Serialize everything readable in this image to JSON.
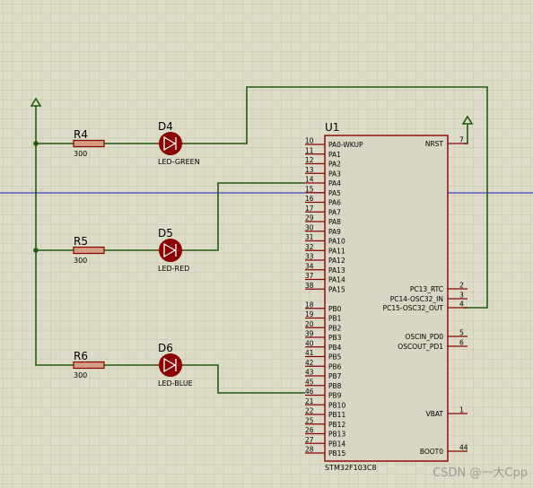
{
  "colors": {
    "background": "#dcdcc8",
    "grid": "#c4c4ad",
    "wire": "#1f5a12",
    "component": "#8b0000",
    "chip_fill": "#d8d7c5",
    "text": "#000000",
    "guide_line": "#1d1dbb"
  },
  "resistors": [
    {
      "ref": "R4",
      "value": "300"
    },
    {
      "ref": "R5",
      "value": "300"
    },
    {
      "ref": "R6",
      "value": "300"
    }
  ],
  "leds": [
    {
      "ref": "D4",
      "label": "LED-GREEN"
    },
    {
      "ref": "D5",
      "label": "LED-RED"
    },
    {
      "ref": "D6",
      "label": "LED-BLUE"
    }
  ],
  "chip": {
    "ref": "U1",
    "part": "STM32F103C8",
    "left_pins": [
      {
        "num": "10",
        "name": "PA0-WKUP"
      },
      {
        "num": "11",
        "name": "PA1"
      },
      {
        "num": "12",
        "name": "PA2"
      },
      {
        "num": "13",
        "name": "PA3"
      },
      {
        "num": "14",
        "name": "PA4"
      },
      {
        "num": "15",
        "name": "PA5"
      },
      {
        "num": "16",
        "name": "PA6"
      },
      {
        "num": "17",
        "name": "PA7"
      },
      {
        "num": "29",
        "name": "PA8"
      },
      {
        "num": "30",
        "name": "PA9"
      },
      {
        "num": "31",
        "name": "PA10"
      },
      {
        "num": "32",
        "name": "PA11"
      },
      {
        "num": "33",
        "name": "PA12"
      },
      {
        "num": "34",
        "name": "PA13"
      },
      {
        "num": "37",
        "name": "PA14"
      },
      {
        "num": "38",
        "name": "PA15"
      },
      {
        "num": "18",
        "name": "PB0"
      },
      {
        "num": "19",
        "name": "PB1"
      },
      {
        "num": "20",
        "name": "PB2"
      },
      {
        "num": "39",
        "name": "PB3"
      },
      {
        "num": "40",
        "name": "PB4"
      },
      {
        "num": "41",
        "name": "PB5"
      },
      {
        "num": "42",
        "name": "PB6"
      },
      {
        "num": "43",
        "name": "PB7"
      },
      {
        "num": "45",
        "name": "PB8"
      },
      {
        "num": "46",
        "name": "PB9"
      },
      {
        "num": "21",
        "name": "PB10"
      },
      {
        "num": "22",
        "name": "PB11"
      },
      {
        "num": "25",
        "name": "PB12"
      },
      {
        "num": "26",
        "name": "PB13"
      },
      {
        "num": "27",
        "name": "PB14"
      },
      {
        "num": "28",
        "name": "PB15"
      }
    ],
    "right_pins": [
      {
        "num": "7",
        "name": "NRST"
      },
      {
        "num": "2",
        "name": "PC13_RTC"
      },
      {
        "num": "3",
        "name": "PC14-OSC32_IN"
      },
      {
        "num": "4",
        "name": "PC15-OSC32_OUT"
      },
      {
        "num": "5",
        "name": "OSCIN_PD0"
      },
      {
        "num": "6",
        "name": "OSCOUT_PD1"
      },
      {
        "num": "1",
        "name": "VBAT"
      },
      {
        "num": "44",
        "name": "BOOT0"
      }
    ]
  },
  "watermark": "CSDN @一大Cpp"
}
